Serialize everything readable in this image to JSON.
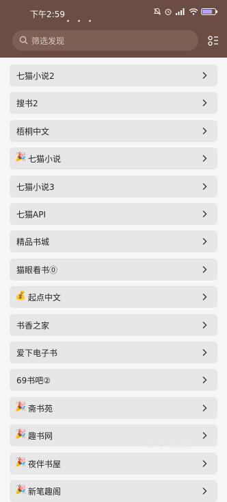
{
  "status": {
    "time": "下午2:59"
  },
  "search": {
    "placeholder": "筛选发现"
  },
  "items": [
    {
      "emoji": "",
      "label": "七猫小说2"
    },
    {
      "emoji": "",
      "label": "搜书2"
    },
    {
      "emoji": "",
      "label": "梧桐中文"
    },
    {
      "emoji": "🎉",
      "label": "七猫小说"
    },
    {
      "emoji": "",
      "label": "七猫小说3"
    },
    {
      "emoji": "",
      "label": "七猫API"
    },
    {
      "emoji": "",
      "label": "精品书城"
    },
    {
      "emoji": "",
      "label": "猫眼看书⓪"
    },
    {
      "emoji": "💰",
      "label": "起点中文"
    },
    {
      "emoji": "",
      "label": "书香之家"
    },
    {
      "emoji": "",
      "label": "爱下电子书"
    },
    {
      "emoji": "",
      "label": "69书吧②"
    },
    {
      "emoji": "🎉",
      "label": "斋书苑"
    },
    {
      "emoji": "🎉",
      "label": "趣书网"
    },
    {
      "emoji": "🎉",
      "label": "夜伴书屋"
    },
    {
      "emoji": "🎉",
      "label": "新笔趣阁"
    }
  ],
  "watermark": "78下载站",
  "colors": {
    "header": "#6b4d43",
    "row_bg": "#e7e7e7",
    "page_bg": "#f6f6f6"
  }
}
